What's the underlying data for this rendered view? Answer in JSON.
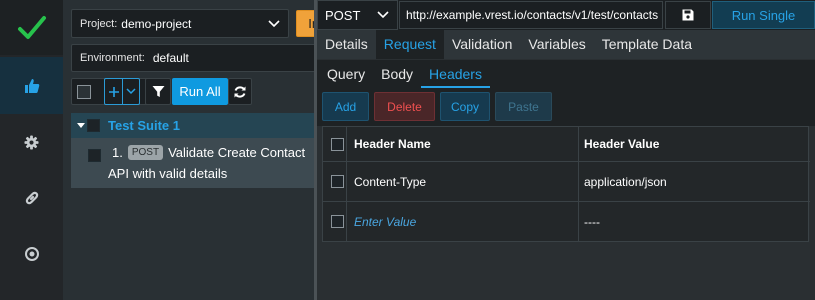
{
  "colors": {
    "accent": "#27a2e6",
    "importer": "#f0a23a",
    "delete": "#f05050",
    "success": "#27c24c"
  },
  "rail": {
    "icons": [
      "check-logo-icon",
      "thumbs-up-icon",
      "gear-icon",
      "link-icon",
      "target-icon"
    ],
    "active": "thumbs-up-icon"
  },
  "suite_panel": {
    "project_label": "Project:",
    "project_value": "demo-project",
    "importer_label": "Importer",
    "environment_label": "Environment:",
    "environment_value": "default",
    "run_all_label": "Run All",
    "suite": {
      "name": "Test Suite 1",
      "tests": [
        {
          "number": "1.",
          "method": "POST",
          "title_line1": "Validate Create Contact",
          "title_line2": "API with valid details"
        }
      ]
    }
  },
  "request": {
    "method": "POST",
    "url": "http://example.vrest.io/contacts/v1/test/contacts",
    "run_single_label": "Run Single",
    "tabs": [
      {
        "label": "Details"
      },
      {
        "label": "Request",
        "active": true
      },
      {
        "label": "Validation"
      },
      {
        "label": "Variables"
      },
      {
        "label": "Template Data"
      }
    ],
    "subtabs": [
      {
        "label": "Query"
      },
      {
        "label": "Body"
      },
      {
        "label": "Headers",
        "active": true
      }
    ],
    "actions": {
      "add": "Add",
      "delete": "Delete",
      "copy": "Copy",
      "paste": "Paste"
    },
    "headers_table": {
      "columns": [
        "Header Name",
        "Header Value"
      ],
      "rows": [
        {
          "name": "Content-Type",
          "value": "application/json"
        }
      ],
      "new_row": {
        "name_placeholder": "Enter Value",
        "value": "----"
      }
    }
  }
}
